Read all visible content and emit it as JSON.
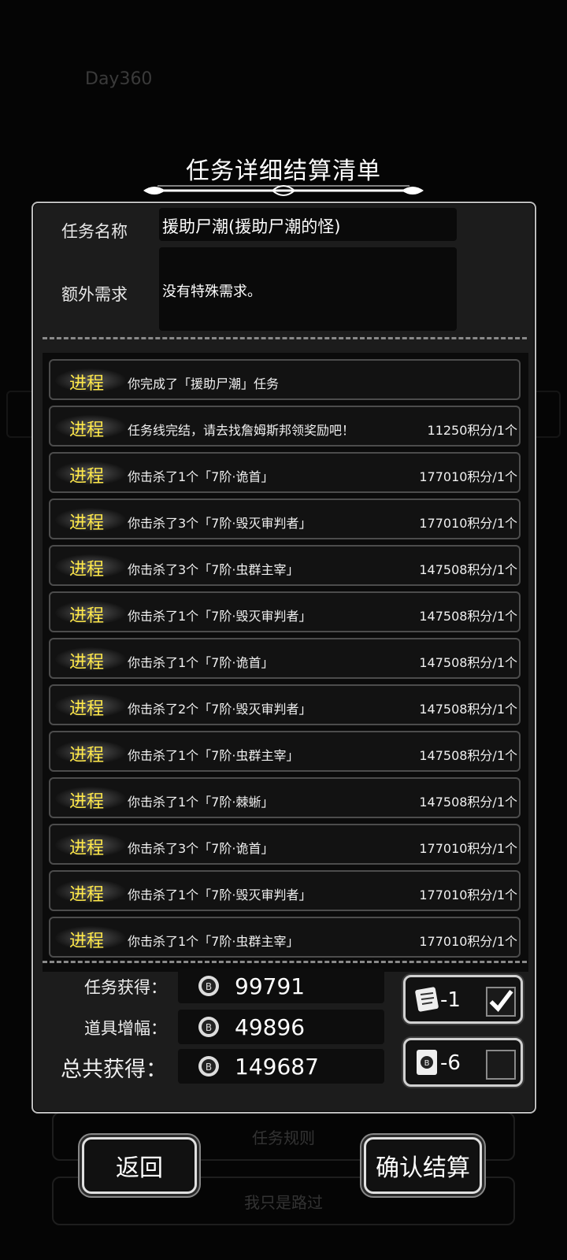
{
  "background": {
    "day": "Day360",
    "rule_button": "任务规则",
    "pass_button": "我只是路过"
  },
  "dialog": {
    "title": "任务详细结算清单",
    "task_name_label": "任务名称",
    "task_name": "援助尸潮(援助尸潮的怪)",
    "extra_req_label": "额外需求",
    "extra_req": "没有特殊需求。",
    "progress_tag": "进程",
    "rows": [
      {
        "desc": "你完成了「援助尸潮」任务",
        "pts": ""
      },
      {
        "desc": "任务线完结，请去找詹姆斯邦领奖励吧！",
        "pts": "11250积分/1个"
      },
      {
        "desc": "你击杀了1个「7阶·诡首」",
        "pts": "177010积分/1个"
      },
      {
        "desc": "你击杀了3个「7阶·毁灭审判者」",
        "pts": "177010积分/1个"
      },
      {
        "desc": "你击杀了3个「7阶·虫群主宰」",
        "pts": "147508积分/1个"
      },
      {
        "desc": "你击杀了1个「7阶·毁灭审判者」",
        "pts": "147508积分/1个"
      },
      {
        "desc": "你击杀了1个「7阶·诡首」",
        "pts": "147508积分/1个"
      },
      {
        "desc": "你击杀了2个「7阶·毁灭审判者」",
        "pts": "147508积分/1个"
      },
      {
        "desc": "你击杀了1个「7阶·虫群主宰」",
        "pts": "147508积分/1个"
      },
      {
        "desc": "你击杀了1个「7阶·棘蜥」",
        "pts": "147508积分/1个"
      },
      {
        "desc": "你击杀了3个「7阶·诡首」",
        "pts": "177010积分/1个"
      },
      {
        "desc": "你击杀了1个「7阶·毁灭审判者」",
        "pts": "177010积分/1个"
      },
      {
        "desc": "你击杀了1个「7阶·虫群主宰」",
        "pts": "177010积分/1个"
      }
    ],
    "summary": {
      "task_label": "任务获得：",
      "task_value": "99791",
      "item_label": "道具增幅：",
      "item_value": "49896",
      "total_label": "总共获得：",
      "total_value": "149687"
    },
    "toggles": [
      {
        "icon": "scroll-icon",
        "value": "-1",
        "checked": true
      },
      {
        "icon": "coin-card-icon",
        "value": "-6",
        "checked": false
      }
    ],
    "back_button": "返回",
    "confirm_button": "确认结算"
  },
  "colors": {
    "accent_yellow": "#ffe94a",
    "panel_border": "#bdbdbd",
    "panel_bg": "#1c1c1c"
  }
}
